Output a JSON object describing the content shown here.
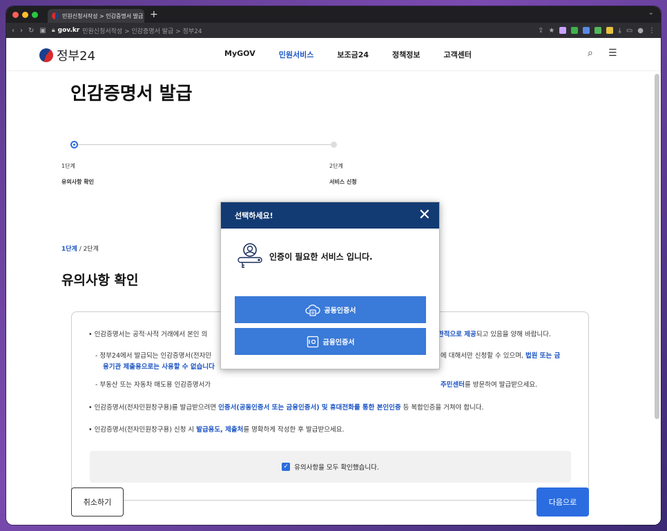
{
  "browser": {
    "tab_title": "민원신청서작성 > 인감증명서 발급",
    "url_domain": "gov.kr",
    "url_path": "민원신청서작성 > 인감증명서 발급 > 정부24"
  },
  "site": {
    "logo_text": "정부24",
    "nav": [
      "MyGOV",
      "민원서비스",
      "보조금24",
      "정책정보",
      "고객센터"
    ]
  },
  "page": {
    "title": "인감증명서 발급",
    "steps": [
      {
        "num": "1단계",
        "label": "유의사항 확인"
      },
      {
        "num": "2단계",
        "label": "서비스 신청"
      }
    ],
    "crumb_current": "1단계",
    "crumb_rest": " / 2단계",
    "section_title": "유의사항 확인",
    "notice": {
      "l1a": "• 인감증명서는 공적·사적 거래에서 본인 의",
      "l1b": "한적으로 제공",
      "l1c": "되고 있음을 양해 바랍니다.",
      "l2a": "- 정부24에서 발급되는 인감증명서(전자민",
      "l2b": "에 대해서만 신청할 수 있으며,",
      "l2c": "법원 또는 금",
      "l2d": "융기관 제출용으로는 사용할 수 없습니다",
      "l3a": "- 부동산 또는 자동차 매도용 인감증명서가",
      "l3b": "주민센터",
      "l3c": "를 방문하여 발급받으세요.",
      "l4a": "• 인감증명서(전자민원창구용)를 발급받으려면 ",
      "l4b": "인증서(공동인증서 또는 금융인증서) 및 휴대전화를 통한 본인인증",
      "l4c": " 등 복합인증을 거쳐야 합니다.",
      "l5a": "• 인감증명서(전자민원창구용) 신청 시 ",
      "l5b": "발급용도, 제출처",
      "l5c": "를 명확하게 작성한 후 발급받으세요."
    },
    "confirm_label": "유의사항을 모두 확인했습니다.",
    "cancel_label": "취소하기",
    "next_label": "다음으로"
  },
  "modal": {
    "title": "선택하세요!",
    "message": "인증이 필요한 서비스 입니다.",
    "buttons": [
      "공동인증서",
      "금융인증서"
    ]
  },
  "colors": {
    "accent": "#2b6de0",
    "modal_header": "#133b73",
    "nav_active": "#1d56c4"
  }
}
